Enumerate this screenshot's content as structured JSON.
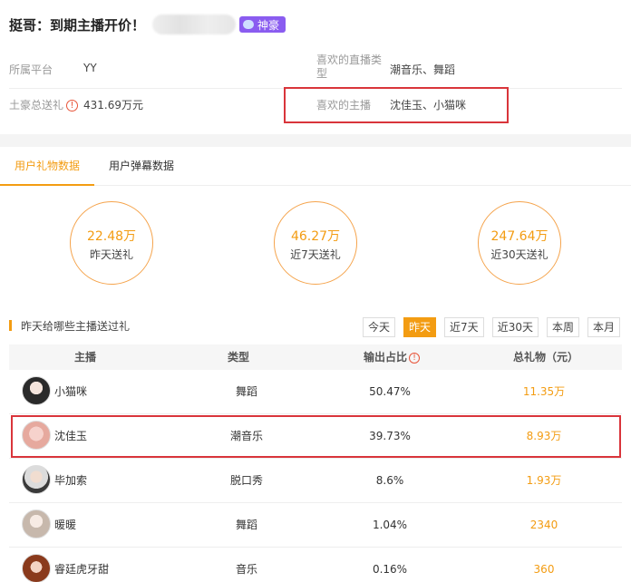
{
  "header": {
    "title": "挺哥：到期主播开价！",
    "badge": "神豪"
  },
  "info": {
    "platform_label": "所属平台",
    "platform_value": "YY",
    "fav_type_label": "喜欢的直播类型",
    "fav_type_value": "潮音乐、舞蹈",
    "total_label": "土豪总送礼",
    "total_value": "431.69万元",
    "fav_anchor_label": "喜欢的主播",
    "fav_anchor_value": "沈佳玉、小猫咪"
  },
  "tabs": [
    {
      "label": "用户礼物数据",
      "active": true
    },
    {
      "label": "用户弹幕数据",
      "active": false
    }
  ],
  "stats": [
    {
      "value": "22.48万",
      "label": "昨天送礼"
    },
    {
      "value": "46.27万",
      "label": "近7天送礼"
    },
    {
      "value": "247.64万",
      "label": "近30天送礼"
    }
  ],
  "section": {
    "title": "昨天给哪些主播送过礼"
  },
  "periods": [
    {
      "label": "今天",
      "active": false
    },
    {
      "label": "昨天",
      "active": true
    },
    {
      "label": "近7天",
      "active": false
    },
    {
      "label": "近30天",
      "active": false
    },
    {
      "label": "本周",
      "active": false
    },
    {
      "label": "本月",
      "active": false
    }
  ],
  "table": {
    "headers": [
      "主播",
      "类型",
      "输出占比",
      "总礼物（元）"
    ],
    "rows": [
      {
        "name": "小猫咪",
        "type": "舞蹈",
        "pct": "50.47%",
        "total": "11.35万"
      },
      {
        "name": "沈佳玉",
        "type": "潮音乐",
        "pct": "39.73%",
        "total": "8.93万"
      },
      {
        "name": "毕加索",
        "type": "脱口秀",
        "pct": "8.6%",
        "total": "1.93万"
      },
      {
        "name": "暖暖",
        "type": "舞蹈",
        "pct": "1.04%",
        "total": "2340"
      },
      {
        "name": "睿廷虎牙甜",
        "type": "音乐",
        "pct": "0.16%",
        "total": "360"
      }
    ]
  },
  "colors": {
    "accent": "#f39c12",
    "badge": "#8a5cf0",
    "highlight": "#d9353b"
  }
}
